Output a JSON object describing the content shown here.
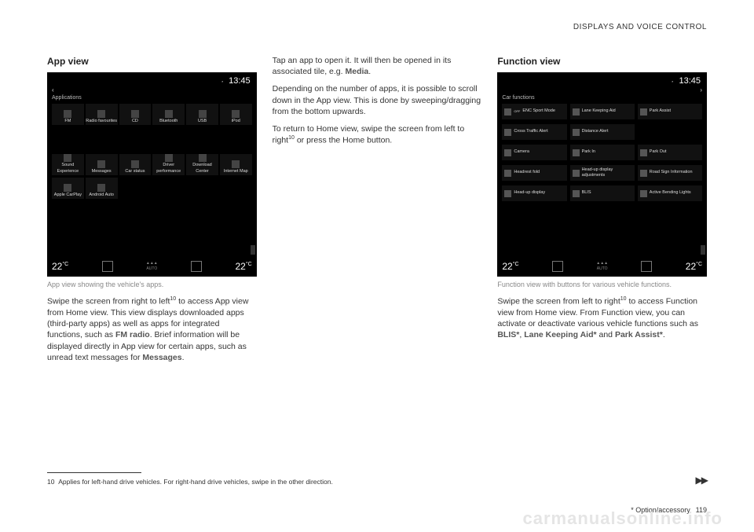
{
  "header": {
    "section": "DISPLAYS AND VOICE CONTROL"
  },
  "col1": {
    "title": "App view",
    "ss": {
      "time": "13:45",
      "back": "‹",
      "label": "Applications",
      "apps_row1": [
        "FM",
        "Radio favourites",
        "CD",
        "Bluetooth",
        "USB",
        "iPod"
      ],
      "apps_row2": [
        "Sound Experience",
        "Messages",
        "Car status",
        "Driver performance",
        "Download Center",
        "Internet Map"
      ],
      "apps_row3": [
        "Apple CarPlay",
        "Android Auto"
      ],
      "temp_left": "22",
      "temp_unit": "°C",
      "auto": "AUTO",
      "temp_right": "22"
    },
    "caption": "App view showing the vehicle's apps.",
    "para1a": "Swipe the screen from right to left",
    "para1_sup": "10",
    "para1b": " to access App view from Home view. This view displays downloaded apps (third-party apps) as well as apps for integrated functions, such as ",
    "para1_bold1": "FM radio",
    "para1c": ". Brief information will be displayed directly in App view for certain apps, such as unread text messages for ",
    "para1_bold2": "Messages",
    "para1d": "."
  },
  "col2": {
    "para1a": "Tap an app to open it. It will then be opened in its associated tile, e.g. ",
    "para1_bold": "Media",
    "para1b": ".",
    "para2": "Depending on the number of apps, it is possible to scroll down in the App view. This is done by sweeping/dragging from the bottom upwards.",
    "para3a": "To return to Home view, swipe the screen from left to right",
    "para3_sup": "10",
    "para3b": " or press the Home button."
  },
  "col3": {
    "title": "Function view",
    "ss": {
      "time": "13:45",
      "back": "›",
      "label": "Car functions",
      "funcs": [
        "ENC Sport Mode",
        "Lane Keeping Aid",
        "Park Assist",
        "Cross Traffic Alert",
        "Distance Alert",
        "",
        "Camera",
        "Park In",
        "Park Out",
        "Headrest fold",
        "Head-up display adjustments",
        "Road Sign Information",
        "Head-up display",
        "BLIS",
        "Active Bending Lights"
      ],
      "off_prefix": "OFF",
      "temp_left": "22",
      "temp_unit": "°C",
      "auto": "AUTO",
      "temp_right": "22"
    },
    "caption": "Function view with buttons for various vehicle functions.",
    "para1a": "Swipe the screen from left to right",
    "para1_sup": "10",
    "para1b": " to access Function view from Home view. From Function view, you can activate or deactivate various vehicle functions such as ",
    "para1_bold1": "BLIS*",
    "para1c": ", ",
    "para1_bold2": "Lane Keeping Aid*",
    "para1d": " and ",
    "para1_bold3": "Park Assist*",
    "para1e": "."
  },
  "footnote": {
    "num": "10",
    "text": "Applies for left-hand drive vehicles. For right-hand drive vehicles, swipe in the other direction."
  },
  "footer": {
    "option": "* Option/accessory.",
    "page": "119",
    "continued": "▶▶"
  },
  "watermark": "carmanualsonline.info"
}
